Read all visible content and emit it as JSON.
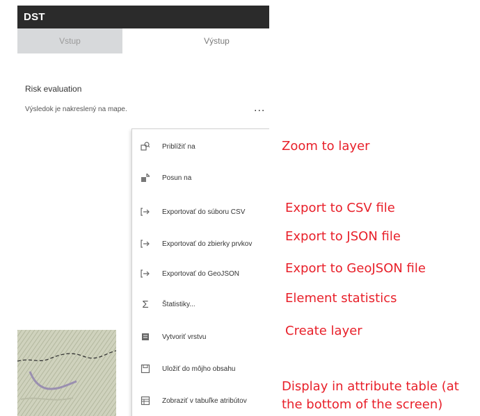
{
  "panel": {
    "title": "DST",
    "tabs": [
      {
        "label": "Vstup",
        "active": true
      },
      {
        "label": "Výstup",
        "active": false
      }
    ],
    "section_title": "Risk evaluation",
    "result_text": "Výsledok je nakreslený na mape.",
    "more_label": "..."
  },
  "menu": {
    "items": [
      {
        "label": "Priblížiť na",
        "icon": "zoom-to-icon"
      },
      {
        "label": "Posun na",
        "icon": "pan-to-icon"
      },
      {
        "label": "Exportovať do súboru CSV",
        "icon": "export-icon"
      },
      {
        "label": "Exportovať do zbierky prvkov",
        "icon": "export-icon"
      },
      {
        "label": "Exportovať do GeoJSON",
        "icon": "export-icon"
      },
      {
        "label": "Štatistiky...",
        "icon": "sigma-icon"
      },
      {
        "label": "Vytvoriť vrstvu",
        "icon": "layer-icon"
      },
      {
        "label": "Uložiť do môjho obsahu",
        "icon": "save-icon"
      },
      {
        "label": "Zobraziť v tabuľke atribútov",
        "icon": "table-icon"
      }
    ]
  },
  "annotations": {
    "zoom": "Zoom to layer",
    "csv": "Export to CSV file",
    "json": "Export to JSON file",
    "geojson": "Export to GeoJSON file",
    "stats": "Element statistics",
    "layer": "Create layer",
    "table_line1": "Display in attribute table (at",
    "table_line2": "the bottom of the screen)"
  },
  "colors": {
    "titlebar": "#2b2b2b",
    "annotation": "#e8202a",
    "active_tab": "#d7d9db"
  }
}
